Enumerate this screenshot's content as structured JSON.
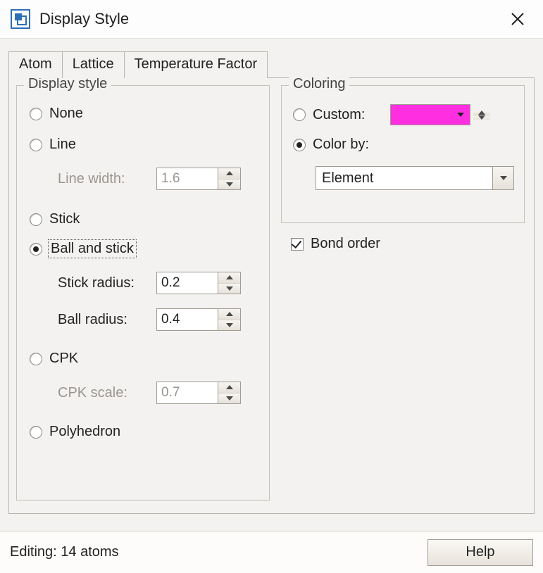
{
  "window": {
    "title": "Display Style"
  },
  "tabs": {
    "atom": "Atom",
    "lattice": "Lattice",
    "temperature": "Temperature Factor"
  },
  "display_style": {
    "legend": "Display style",
    "none": "None",
    "line": "Line",
    "line_width_label": "Line width:",
    "line_width_value": "1.6",
    "stick": "Stick",
    "ball_and_stick": "Ball and stick",
    "stick_radius_label": "Stick radius:",
    "stick_radius_value": "0.2",
    "ball_radius_label": "Ball radius:",
    "ball_radius_value": "0.4",
    "cpk": "CPK",
    "cpk_scale_label": "CPK scale:",
    "cpk_scale_value": "0.7",
    "polyhedron": "Polyhedron"
  },
  "coloring": {
    "legend": "Coloring",
    "custom": "Custom:",
    "custom_color": "#ff2ee1",
    "color_by": "Color by:",
    "color_by_value": "Element"
  },
  "bond_order": "Bond order",
  "status": "Editing: 14 atoms",
  "help": "Help"
}
